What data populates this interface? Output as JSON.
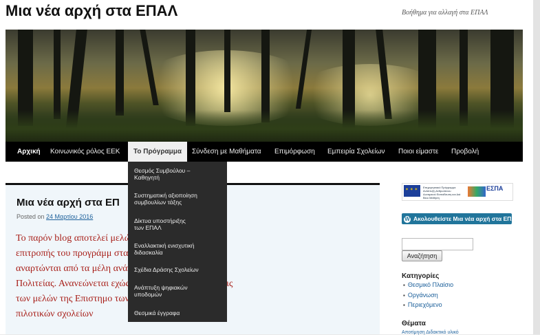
{
  "site": {
    "title": "Μια νέα αρχή στα ΕΠΑΛ",
    "tagline": "Βοήθημα για αλλαγή στα ΕΠΑΛ"
  },
  "nav": {
    "items": [
      {
        "label": "Αρχική"
      },
      {
        "label": "Κοινωνικός ρόλος ΕΕΚ"
      },
      {
        "label": "Το Πρόγραμμα"
      },
      {
        "label": "Σύνδεση με Μαθήματα"
      },
      {
        "label": "Επιμόρφωση"
      },
      {
        "label": "Εμπειρία Σχολείων"
      },
      {
        "label": "Ποιοι είμαστε"
      },
      {
        "label": "Προβολή"
      }
    ],
    "active": "Το Πρόγραμμα"
  },
  "dropdown": {
    "items": [
      {
        "line1": "Θεσμός Συμβούλου –",
        "line2": " Καθηγητή"
      },
      {
        "line1": "Συστηματική αξιοποίηση",
        "line2": "συμβουλίων τάξης"
      },
      {
        "line1": "Δίκτυα υποστήριξης",
        "line2": "των ΕΠΑΛ"
      },
      {
        "line1": "Εναλλακτική ενισχυτική",
        "line2": "διδασκαλία"
      },
      {
        "line1": "Σχέδια Δράσης Σχολείων",
        "line2": ""
      },
      {
        "line1": "Ανάπτυξη ψηφιακών",
        "line2": "υποδομών"
      },
      {
        "line1": "Θεσμικά έγγραφα",
        "line2": ""
      }
    ]
  },
  "post": {
    "title": "Μια νέα αρχή στα ΕΠ",
    "posted_prefix": "Posted on",
    "date": "24 Μαρτίου 2016",
    "body_lines": [
      "Το παρόν blog  αποτελεί                             μελών της επιστημονικής",
      "επιτροπής του προγράμμ                              στα ΕΠΑΛ». Τα κείμενα που",
      "αναρτώνται από τα μέλη                              ανάγκη επίσημες απόψεις τις",
      "Πολιτείας.  Ανανεώνεται                             εχώς με βάση τις παρατηρήσεις",
      "των μελών της Επιστημο                              των εκπαιδευτικών των",
      "πιλοτικών σχολείων"
    ]
  },
  "sidebar": {
    "logo_caption": "Επιχειρησιακό Πρόγραμμα Ανάπτυξη Ανθρώπινου Δυναμικού Εκπαίδευση και Διά Βίου Μάθηση",
    "logo_espa": "ΕΣΠΑ",
    "follow_label": "Ακολουθείστε Μια νέα αρχή στα ΕΠΑΛ",
    "search_value": "",
    "search_button": "Αναζήτηση",
    "categories_title": "Κατηγορίες",
    "categories": [
      "Θεσμικό Πλαίσιο",
      "Οργάνωση",
      "Περιεχόμενο"
    ],
    "tags_title": "Θέματα",
    "tags_line": "Αποτίμηση Διδακτικό υλικό"
  },
  "colors": {
    "nav_bg": "#000000",
    "dropdown_bg": "#2b2b2b",
    "post_text": "#a8201a",
    "link": "#1b5f9a",
    "follow_button": "#21759b"
  }
}
